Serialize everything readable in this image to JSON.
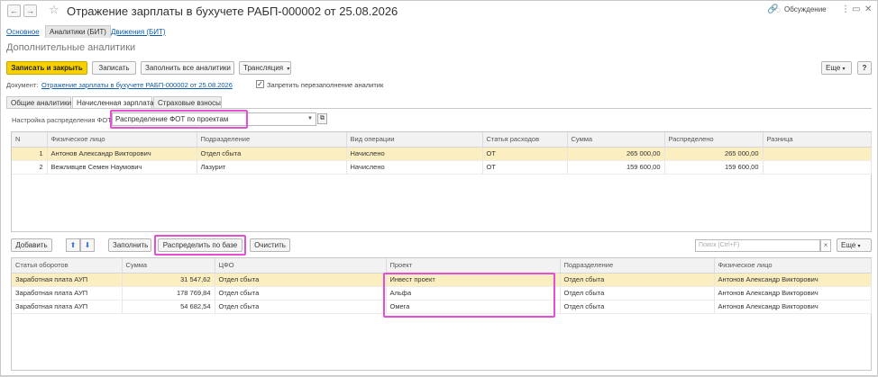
{
  "window": {
    "title": "Отражение зарплаты в бухучете РАБП-000002 от 25.08.2026",
    "discussion_label": "Обсуждение"
  },
  "top_tabs": [
    "Основное",
    "Аналитики (БИТ)",
    "Движения (БИТ)"
  ],
  "subtitle": "Дополнительные аналитики",
  "toolbar": {
    "save_close": "Записать и закрыть",
    "save": "Записать",
    "fill_all": "Заполнить все аналитики",
    "translation": "Трансляция",
    "more": "Еще",
    "help": "?"
  },
  "document": {
    "label": "Документ:",
    "link": "Отражение зарплаты в бухучете РАБП-000002 от 25.08.2026",
    "forbid_label": "Запретить перезаполнение аналитик"
  },
  "inner_tabs": [
    "Общие аналитики",
    "Начисленная зарплата",
    "Страховые взносы"
  ],
  "distribution": {
    "label": "Настройка распределения ФОТ:",
    "value": "Распределение ФОТ по проектам"
  },
  "top_table": {
    "columns": [
      "N",
      "Физическое лицо",
      "Подразделение",
      "Вид операции",
      "Статья расходов",
      "Сумма",
      "Распределено",
      "Разница"
    ],
    "rows": [
      [
        "1",
        "Антонов Александр Викторович",
        "Отдел сбыта",
        "Начислено",
        "ОТ",
        "265 000,00",
        "265 000,00",
        ""
      ],
      [
        "2",
        "Вежливцев Семен Наумович",
        "Лазурит",
        "Начислено",
        "ОТ",
        "159 600,00",
        "159 600,00",
        ""
      ]
    ]
  },
  "bottom_toolbar": {
    "add": "Добавить",
    "fill": "Заполнить",
    "distribute": "Распределить по базе",
    "clear": "Очистить",
    "search_placeholder": "Поиск (Ctrl+F)",
    "more": "Еще"
  },
  "bottom_table": {
    "columns": [
      "Статья оборотов",
      "Сумма",
      "ЦФО",
      "Проект",
      "Подразделение",
      "Физическое лицо"
    ],
    "rows": [
      [
        "Заработная плата АУП",
        "31 547,62",
        "Отдел сбыта",
        "Инвест проект",
        "Отдел сбыта",
        "Антонов Александр Викторович"
      ],
      [
        "Заработная плата АУП",
        "178 769,84",
        "Отдел сбыта",
        "Альфа",
        "Отдел сбыта",
        "Антонов Александр Викторович"
      ],
      [
        "Заработная плата АУП",
        "54 682,54",
        "Отдел сбыта",
        "Омега",
        "Отдел сбыта",
        "Антонов Александр Викторович"
      ]
    ]
  },
  "colors": {
    "accent_yellow": "#f7d000",
    "highlight": "#e64fd4",
    "selected_row": "#fbeec0",
    "link": "#0f5ba7"
  }
}
